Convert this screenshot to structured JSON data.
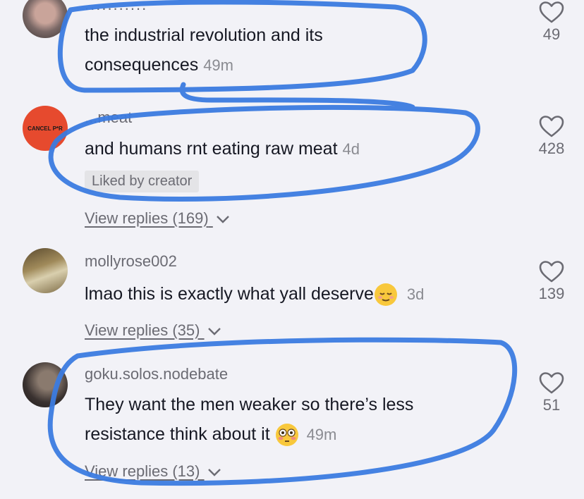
{
  "comments": [
    {
      "username": "...........",
      "text_line1": "the industrial revolution and its",
      "text_line2": "consequences",
      "time": "49m",
      "likes": "49",
      "avatar": "photo-person"
    },
    {
      "username": "...meat",
      "text": "and humans rnt eating raw meat",
      "time": "4d",
      "badge": "Liked by creator",
      "view_replies": "View replies (169)",
      "likes": "428",
      "avatar_text": "CANCEL P*R"
    },
    {
      "username": "mollyrose002",
      "text": "lmao this is exactly what yall deserve",
      "emoji": "relieved-face",
      "time": "3d",
      "view_replies": "View replies (35)",
      "likes": "139",
      "avatar": "photo-outdoor"
    },
    {
      "username": "goku.solos.nodebate",
      "text_line1": "They want the men weaker so there’s less",
      "text_line2": "resistance think about it",
      "emoji": "flushed-face",
      "time": "49m",
      "view_replies": "View replies (13)",
      "likes": "51",
      "avatar": "photo-dark"
    }
  ],
  "annotation_color": "#3b7be0"
}
